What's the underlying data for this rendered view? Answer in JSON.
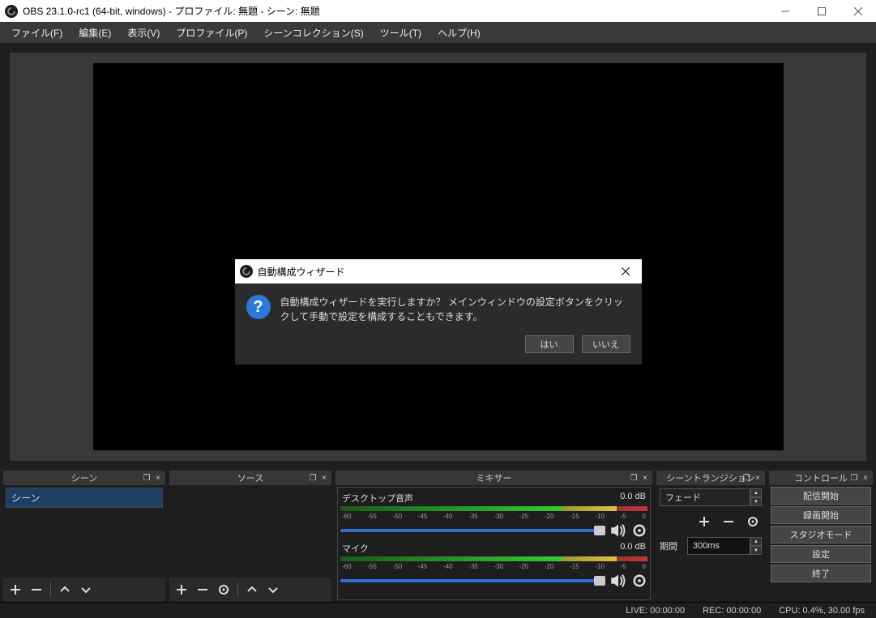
{
  "title": "OBS 23.1.0-rc1 (64-bit, windows) - プロファイル: 無題 - シーン: 無題",
  "menu": [
    "ファイル(F)",
    "編集(E)",
    "表示(V)",
    "プロファイル(P)",
    "シーンコレクション(S)",
    "ツール(T)",
    "ヘルプ(H)"
  ],
  "docks": {
    "scenes": {
      "title": "シーン",
      "items": [
        "シーン"
      ]
    },
    "sources": {
      "title": "ソース"
    },
    "mixer": {
      "title": "ミキサー",
      "items": [
        {
          "name": "デスクトップ音声",
          "db": "0.0 dB"
        },
        {
          "name": "マイク",
          "db": "0.0 dB"
        }
      ],
      "ticks": [
        "-60",
        "-55",
        "-50",
        "-45",
        "-40",
        "-35",
        "-30",
        "-25",
        "-20",
        "-15",
        "-10",
        "-5",
        "0"
      ]
    },
    "transitions": {
      "title": "シーントランジション",
      "value": "フェード",
      "duration_label": "期間",
      "duration": "300ms"
    },
    "controls": {
      "title": "コントロール",
      "buttons": [
        "配信開始",
        "録画開始",
        "スタジオモード",
        "設定",
        "終了"
      ]
    }
  },
  "dialog": {
    "title": "自動構成ウィザード",
    "message": "自動構成ウィザードを実行しますか？ メインウィンドウの設定ボタンをクリックして手動で設定を構成することもできます。",
    "yes": "はい",
    "no": "いいえ"
  },
  "status": {
    "live": "LIVE: 00:00:00",
    "rec": "REC: 00:00:00",
    "cpu": "CPU: 0.4%, 30.00 fps"
  }
}
